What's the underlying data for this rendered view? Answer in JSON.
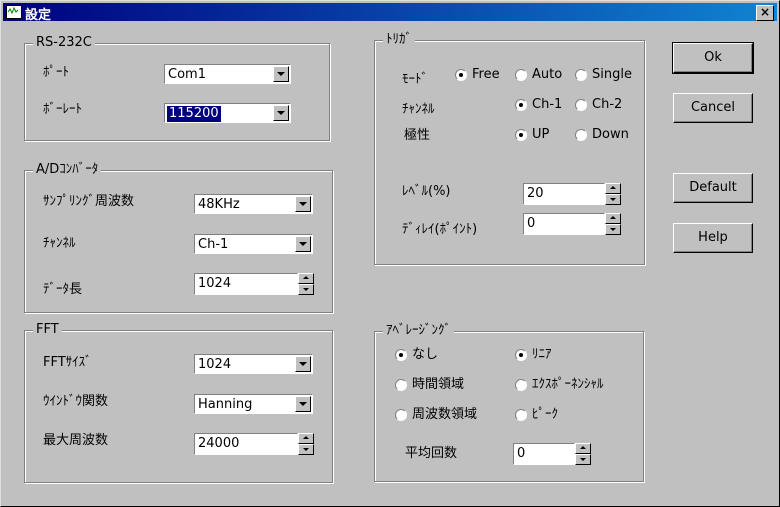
{
  "window": {
    "title": "設定",
    "close_label": "×"
  },
  "rs232c": {
    "title": "RS-232C",
    "port_label": "ﾎﾟｰﾄ",
    "port_value": "Com1",
    "baud_label": "ﾎﾞｰﾚｰﾄ",
    "baud_value": "115200"
  },
  "adc": {
    "title": "A/Dｺﾝﾊﾞｰﾀ",
    "rate_label": "ｻﾝﾌﾟﾘﾝｸﾞ周波数",
    "rate_value": "48KHz",
    "channel_label": "ﾁｬﾝﾈﾙ",
    "channel_value": "Ch-1",
    "length_label": "ﾃﾞｰﾀ長",
    "length_value": "1024"
  },
  "fft": {
    "title": "FFT",
    "size_label": "FFTｻｲｽﾞ",
    "size_value": "1024",
    "window_label": "ｳｲﾝﾄﾞｳ関数",
    "window_value": "Hanning",
    "maxfreq_label": "最大周波数",
    "maxfreq_value": "24000"
  },
  "trigger": {
    "title": "ﾄﾘｶﾞ",
    "mode_label": "ﾓｰﾄﾞ",
    "mode_options": [
      "Free",
      "Auto",
      "Single"
    ],
    "channel_label": "ﾁｬﾝﾈﾙ",
    "channel_options": [
      "Ch-1",
      "Ch-2"
    ],
    "polarity_label": "極性",
    "polarity_options": [
      "UP",
      "Down"
    ],
    "level_label": "ﾚﾍﾞﾙ(%)",
    "level_value": "20",
    "delay_label": "ﾃﾞｨﾚｲ(ﾎﾟｲﾝﾄ)",
    "delay_value": "0"
  },
  "averaging": {
    "title": "ｱﾍﾞﾚｰｼﾞﾝｸﾞ",
    "type_options": [
      "なし",
      "時間領域",
      "周波数領域"
    ],
    "method_options": [
      "ﾘﾆｱ",
      "ｴｸｽﾎﾟｰﾈﾝｼｬﾙ",
      "ﾋﾟｰｸ"
    ],
    "count_label": "平均回数",
    "count_value": "0"
  },
  "buttons": {
    "ok": "Ok",
    "cancel": "Cancel",
    "default": "Default",
    "help": "Help"
  }
}
